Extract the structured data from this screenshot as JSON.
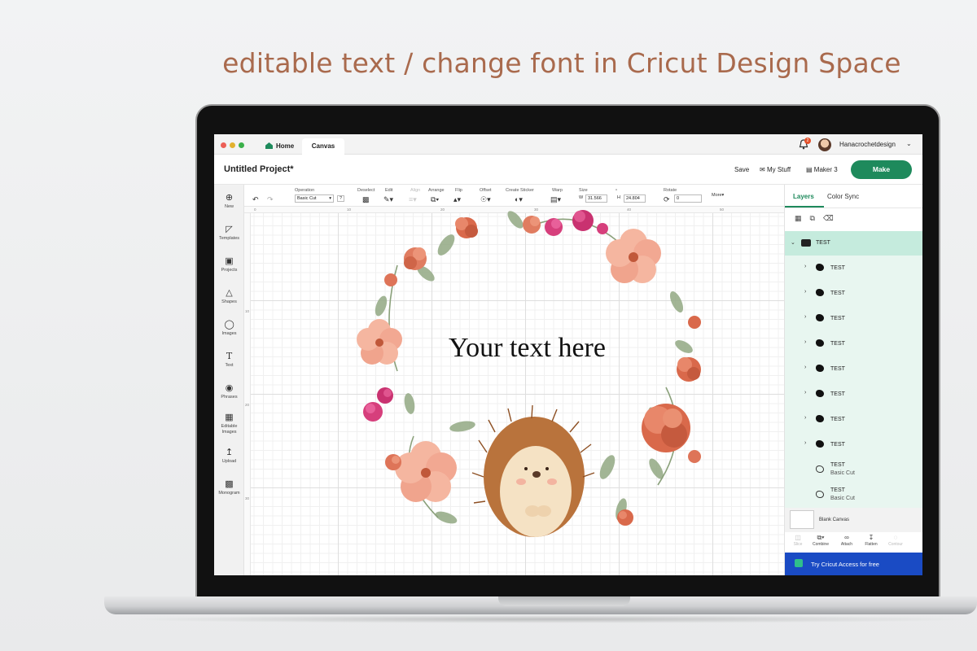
{
  "headline": "editable text / change font in Cricut Design Space",
  "browser": {
    "tabs": [
      {
        "label": "Home"
      },
      {
        "label": "Canvas"
      }
    ],
    "notification_count": "2",
    "username": "Hanacrochetdesign"
  },
  "project": {
    "title": "Untitled Project*",
    "save_label": "Save",
    "my_stuff_label": "My Stuff",
    "machine_label": "Maker 3",
    "make_label": "Make"
  },
  "rail": {
    "items": [
      {
        "label": "New",
        "icon": "plus-circle-icon"
      },
      {
        "label": "Templates",
        "icon": "shirt-icon"
      },
      {
        "label": "Projects",
        "icon": "projects-icon"
      },
      {
        "label": "Shapes",
        "icon": "shapes-icon"
      },
      {
        "label": "Images",
        "icon": "lightbulb-icon"
      },
      {
        "label": "Text",
        "icon": "text-t-icon"
      },
      {
        "label": "Phrases",
        "icon": "speech-bubble-icon"
      },
      {
        "label": "Editable Images",
        "icon": "editable-image-icon"
      },
      {
        "label": "Upload",
        "icon": "upload-icon"
      },
      {
        "label": "Monogram",
        "icon": "monogram-icon"
      }
    ]
  },
  "toolbar": {
    "operation_label": "Operation",
    "operation_value": "Basic Cut",
    "deselect_label": "Deselect",
    "edit_label": "Edit",
    "align_label": "Align",
    "arrange_label": "Arrange",
    "flip_label": "Flip",
    "offset_label": "Offset",
    "sticker_label": "Create Sticker",
    "warp_label": "Warp",
    "size_label": "Size",
    "w_label": "W",
    "w_value": "31.566",
    "h_label": "H",
    "h_value": "24.804",
    "rotate_label": "Rotate",
    "rotate_value": "0",
    "more_label": "More"
  },
  "ruler": {
    "h_ticks": [
      "0",
      "10",
      "20",
      "30",
      "40",
      "50"
    ],
    "v_ticks": [
      "10",
      "20",
      "30"
    ]
  },
  "canvas": {
    "text": "Your text here"
  },
  "panel": {
    "tabs": [
      {
        "label": "Layers"
      },
      {
        "label": "Color Sync"
      }
    ],
    "group_label": "TEST",
    "layers": [
      {
        "name": "TEST",
        "sub": ""
      },
      {
        "name": "TEST",
        "sub": ""
      },
      {
        "name": "TEST",
        "sub": ""
      },
      {
        "name": "TEST",
        "sub": ""
      },
      {
        "name": "TEST",
        "sub": ""
      },
      {
        "name": "TEST",
        "sub": ""
      },
      {
        "name": "TEST",
        "sub": ""
      },
      {
        "name": "TEST",
        "sub": ""
      },
      {
        "name": "TEST",
        "sub": "Basic Cut"
      },
      {
        "name": "TEST",
        "sub": "Basic Cut"
      }
    ],
    "blank_canvas_label": "Blank Canvas",
    "actions": [
      {
        "label": "Slice"
      },
      {
        "label": "Combine"
      },
      {
        "label": "Attach"
      },
      {
        "label": "Flatten"
      },
      {
        "label": "Contour"
      }
    ],
    "access_label": "Try Cricut Access for free"
  },
  "colors": {
    "accent": "#1e8a5c",
    "headline": "#a96a4d",
    "access_bar": "#1a4bc4",
    "layer_selected": "#c5ebdd"
  }
}
